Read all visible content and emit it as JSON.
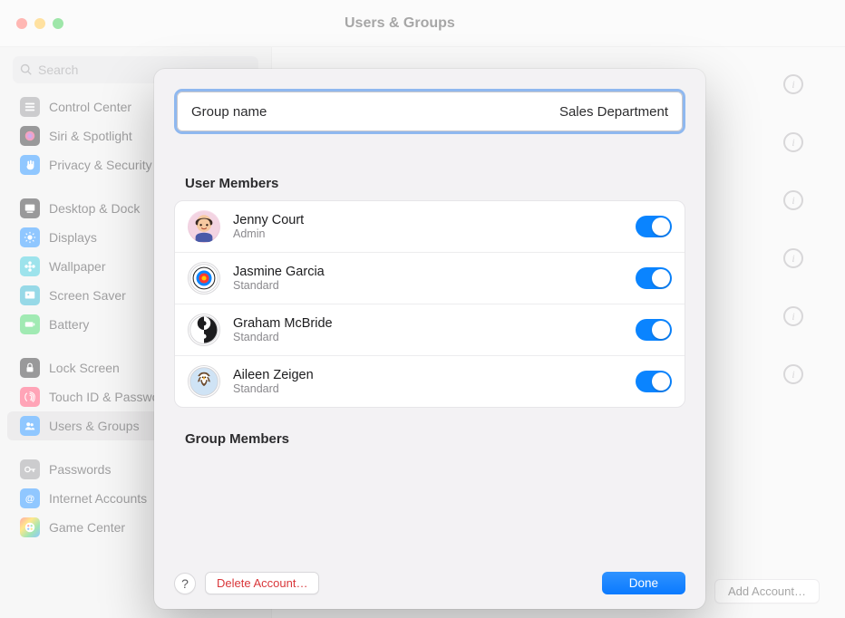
{
  "title": "Users & Groups",
  "search": {
    "placeholder": "Search"
  },
  "sidebar": {
    "items": [
      {
        "label": "Control Center",
        "icon": "sliders",
        "color": "#8e8e93"
      },
      {
        "label": "Siri & Spotlight",
        "icon": "siri",
        "color": "#1d1d1f"
      },
      {
        "label": "Privacy & Security",
        "icon": "hand",
        "color": "#0a84ff"
      },
      {
        "gap": true
      },
      {
        "label": "Desktop & Dock",
        "icon": "dock",
        "color": "#1d1d1f"
      },
      {
        "label": "Displays",
        "icon": "sun",
        "color": "#0a84ff"
      },
      {
        "label": "Wallpaper",
        "icon": "flower",
        "color": "#26c1d6"
      },
      {
        "label": "Screen Saver",
        "icon": "ssaver",
        "color": "#1aacc9"
      },
      {
        "label": "Battery",
        "icon": "battery",
        "color": "#30d158"
      },
      {
        "gap": true
      },
      {
        "label": "Lock Screen",
        "icon": "lock",
        "color": "#1d1d1f"
      },
      {
        "label": "Touch ID & Password",
        "icon": "finger",
        "color": "#ff375f"
      },
      {
        "label": "Users & Groups",
        "icon": "users",
        "color": "#0a84ff",
        "selected": true
      },
      {
        "gap": true
      },
      {
        "label": "Passwords",
        "icon": "key",
        "color": "#8e8e93"
      },
      {
        "label": "Internet Accounts",
        "icon": "at",
        "color": "#0a84ff"
      },
      {
        "label": "Game Center",
        "icon": "game",
        "color": ""
      }
    ]
  },
  "main": {
    "info_count": 6,
    "add_account": "Add Account…"
  },
  "modal": {
    "group_name_label": "Group name",
    "group_name_value": "Sales Department",
    "user_members_title": "User Members",
    "group_members_title": "Group Members",
    "users": [
      {
        "name": "Jenny Court",
        "role": "Admin",
        "on": true,
        "avatar": "jenny"
      },
      {
        "name": "Jasmine Garcia",
        "role": "Standard",
        "on": true,
        "avatar": "jasmine"
      },
      {
        "name": "Graham McBride",
        "role": "Standard",
        "on": true,
        "avatar": "graham"
      },
      {
        "name": "Aileen Zeigen",
        "role": "Standard",
        "on": true,
        "avatar": "aileen"
      }
    ],
    "help": "?",
    "delete": "Delete Account…",
    "done": "Done"
  }
}
